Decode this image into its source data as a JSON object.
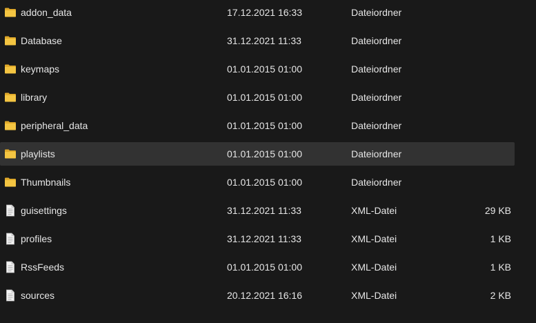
{
  "colors": {
    "background": "#191919",
    "selected_row": "#323232",
    "text": "#e6e6e6",
    "folder_icon": "#f4c542",
    "file_icon": "#f2f2f2"
  },
  "files": [
    {
      "name": "addon_data",
      "date": "17.12.2021 16:33",
      "type": "Dateiordner",
      "size": "",
      "icon": "folder-icon"
    },
    {
      "name": "Database",
      "date": "31.12.2021 11:33",
      "type": "Dateiordner",
      "size": "",
      "icon": "folder-icon"
    },
    {
      "name": "keymaps",
      "date": "01.01.2015 01:00",
      "type": "Dateiordner",
      "size": "",
      "icon": "folder-icon"
    },
    {
      "name": "library",
      "date": "01.01.2015 01:00",
      "type": "Dateiordner",
      "size": "",
      "icon": "folder-icon"
    },
    {
      "name": "peripheral_data",
      "date": "01.01.2015 01:00",
      "type": "Dateiordner",
      "size": "",
      "icon": "folder-icon"
    },
    {
      "name": "playlists",
      "date": "01.01.2015 01:00",
      "type": "Dateiordner",
      "size": "",
      "icon": "folder-icon",
      "selected": true
    },
    {
      "name": "Thumbnails",
      "date": "01.01.2015 01:00",
      "type": "Dateiordner",
      "size": "",
      "icon": "folder-icon"
    },
    {
      "name": "guisettings",
      "date": "31.12.2021 11:33",
      "type": "XML-Datei",
      "size": "29 KB",
      "icon": "document-icon"
    },
    {
      "name": "profiles",
      "date": "31.12.2021 11:33",
      "type": "XML-Datei",
      "size": "1 KB",
      "icon": "document-icon"
    },
    {
      "name": "RssFeeds",
      "date": "01.01.2015 01:00",
      "type": "XML-Datei",
      "size": "1 KB",
      "icon": "document-icon"
    },
    {
      "name": "sources",
      "date": "20.12.2021 16:16",
      "type": "XML-Datei",
      "size": "2 KB",
      "icon": "document-icon"
    }
  ]
}
